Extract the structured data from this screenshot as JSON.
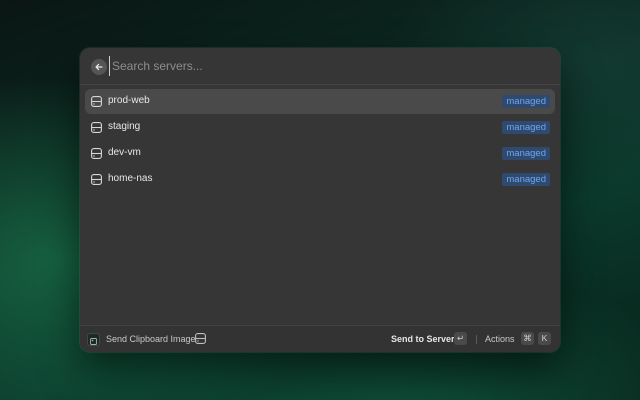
{
  "search": {
    "placeholder": "Search servers...",
    "value": ""
  },
  "servers": [
    {
      "name": "prod-web",
      "badge": "managed",
      "selected": true
    },
    {
      "name": "staging",
      "badge": "managed",
      "selected": false
    },
    {
      "name": "dev-vm",
      "badge": "managed",
      "selected": false
    },
    {
      "name": "home-nas",
      "badge": "managed",
      "selected": false
    }
  ],
  "footer": {
    "title": "Send Clipboard Image",
    "primary_action": "Send to Server",
    "primary_shortcut": "↵",
    "actions_label": "Actions",
    "actions_shortcut_mod": "⌘",
    "actions_shortcut_key": "K"
  },
  "icons": {
    "back": "arrow-left-icon",
    "server": "server-icon",
    "app": "app-icon"
  },
  "colors": {
    "window_bg": "#363636",
    "selected_row": "#4a4a4a",
    "badge_bg": "#2f4a6e",
    "badge_text": "#6ea6ef"
  }
}
